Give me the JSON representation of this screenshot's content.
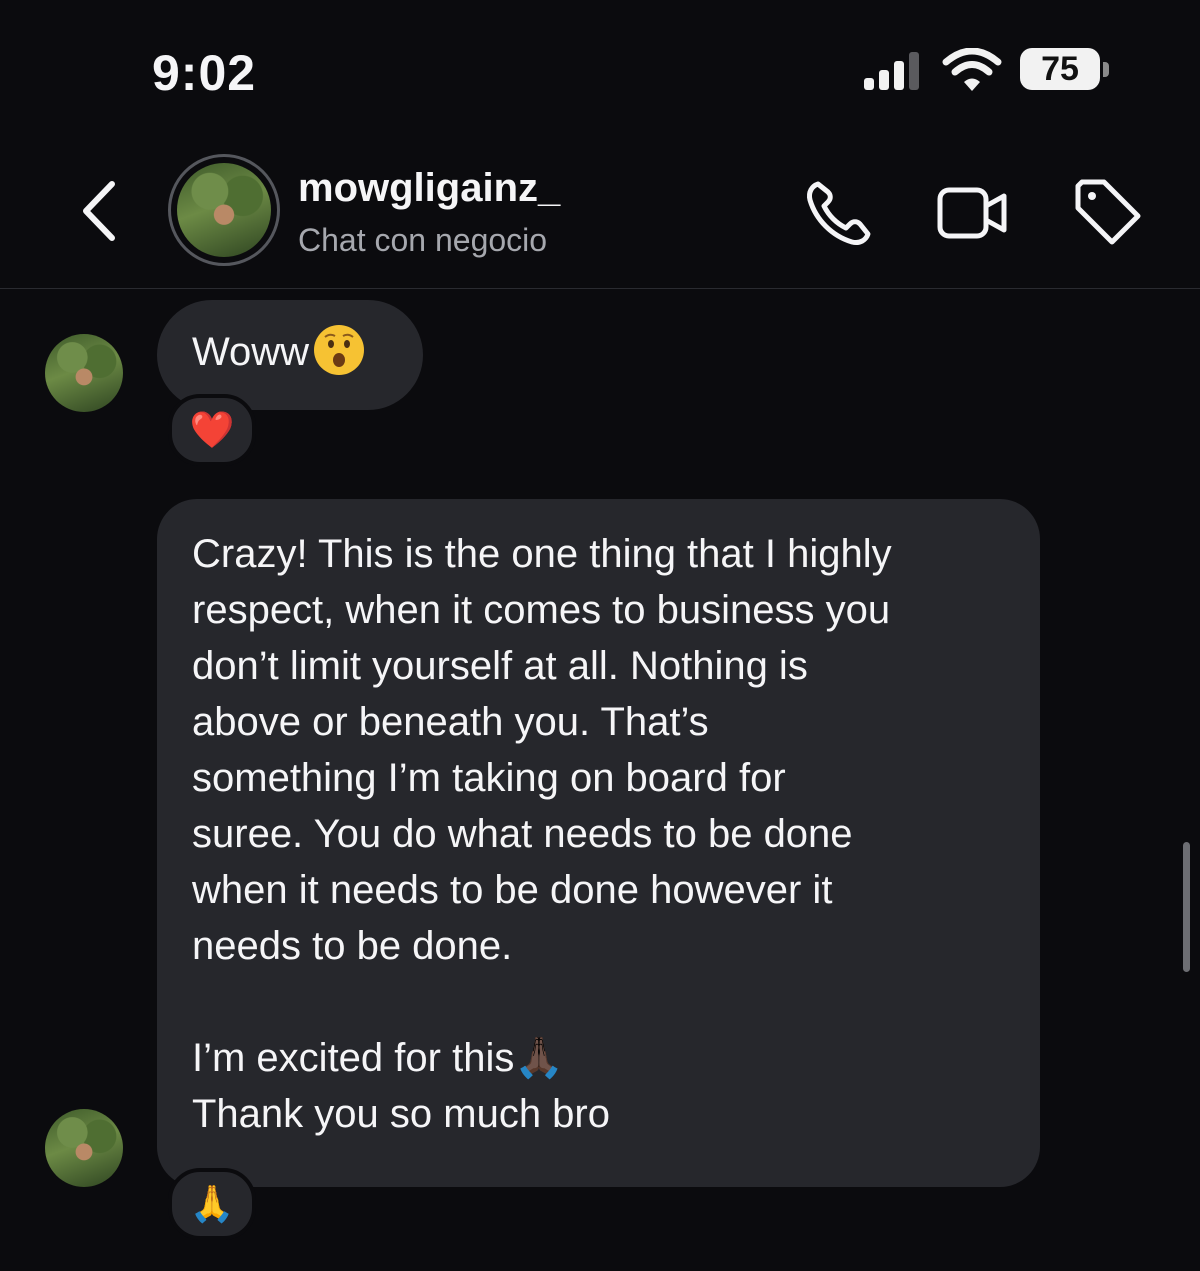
{
  "status_bar": {
    "time": "9:02",
    "battery": "75",
    "signal_icon": "cellular-signal-icon",
    "wifi_icon": "wifi-icon"
  },
  "header": {
    "username": "mowgligainz_",
    "subtitle": "Chat con negocio",
    "back_icon": "chevron-left-icon",
    "call_icon": "phone-icon",
    "video_icon": "video-camera-icon",
    "tag_icon": "tag-icon"
  },
  "messages": [
    {
      "text": "Woww",
      "emoji": "astonished-face",
      "reaction": "❤️"
    },
    {
      "lines": [
        "Crazy! This is the one thing that I highly",
        "respect, when it comes to business you",
        "don’t limit yourself at all. Nothing is",
        "above or beneath you. That’s",
        "something I’m taking on board for",
        "suree. You do what needs to be done",
        "when it needs to be done however it",
        "needs to be done.",
        "I’m excited for this🙏🏿",
        "Thank you so much bro"
      ],
      "reaction": "🙏"
    }
  ],
  "colors": {
    "background": "#0b0b0e",
    "bubble": "#26272c",
    "text": "#f5f5f7",
    "muted": "#a6a8ae"
  }
}
